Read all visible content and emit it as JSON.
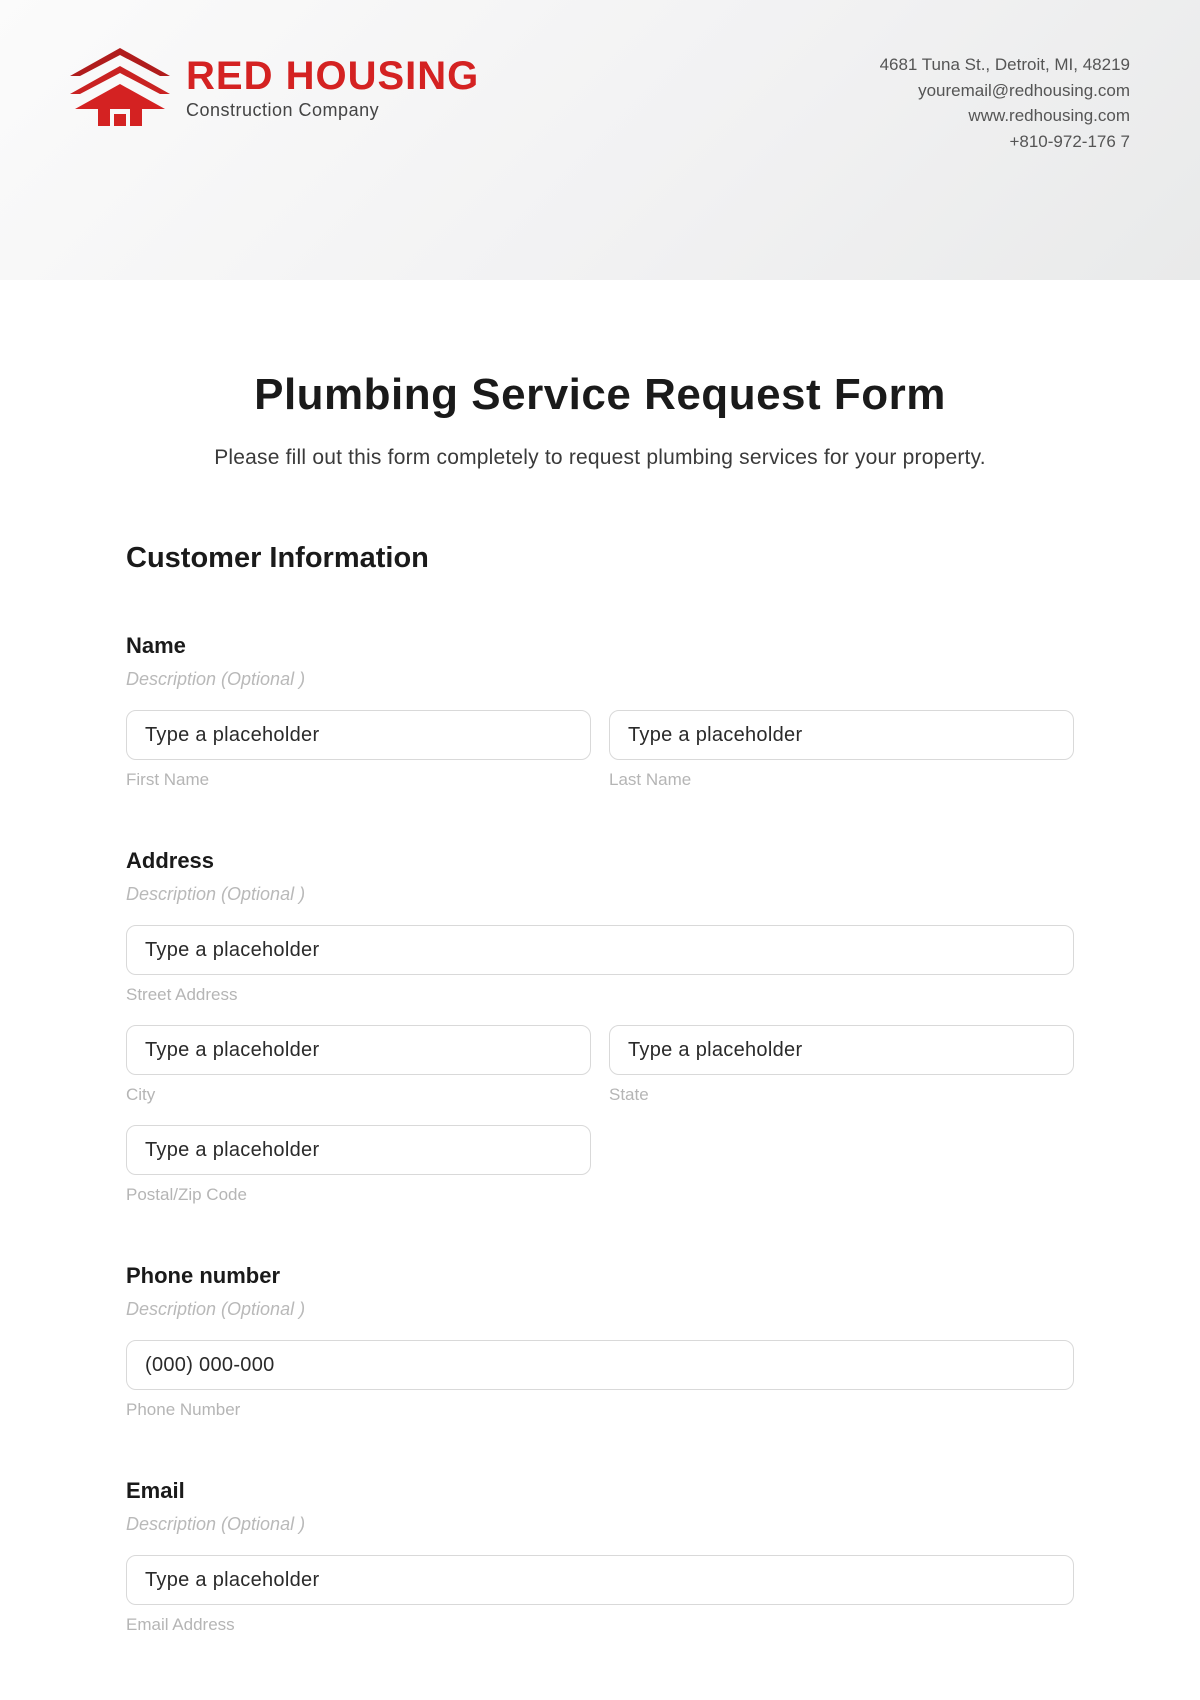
{
  "header": {
    "brand_name": "RED HOUSING",
    "brand_sub": "Construction Company",
    "contact": {
      "line1": "4681 Tuna St., Detroit, MI, 48219",
      "line2": "youremail@redhousing.com",
      "line3": "www.redhousing.com",
      "line4": "+810-972-176 7"
    }
  },
  "form": {
    "title": "Plumbing Service Request Form",
    "intro": "Please fill out this form completely to request plumbing services for your property.",
    "section_customer": "Customer Information",
    "common": {
      "desc_optional": "Description  (Optional )",
      "placeholder_generic": "Type a placeholder"
    },
    "name": {
      "label": "Name",
      "first_sub": "First Name",
      "last_sub": "Last Name"
    },
    "address": {
      "label": "Address",
      "street_sub": "Street Address",
      "city_sub": "City",
      "state_sub": "State",
      "zip_sub": "Postal/Zip Code"
    },
    "phone": {
      "label": "Phone number",
      "placeholder": "(000) 000-000",
      "sub": "Phone Number"
    },
    "email": {
      "label": "Email",
      "sub": "Email Address"
    }
  }
}
